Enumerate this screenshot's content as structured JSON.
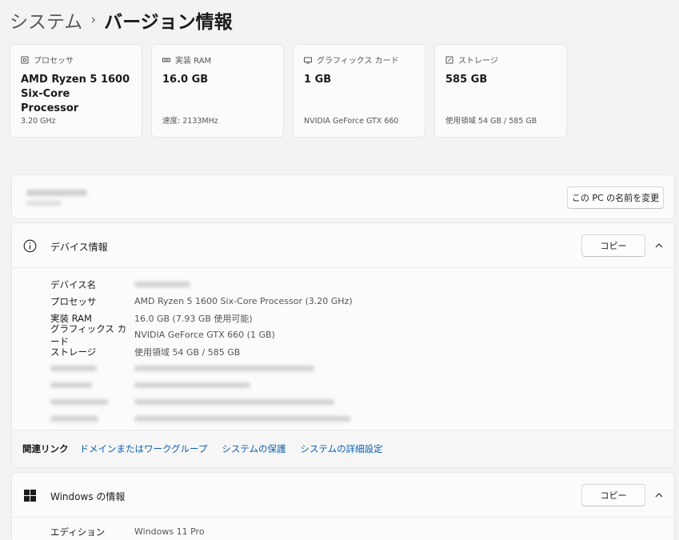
{
  "breadcrumb": {
    "parent": "システム",
    "separator": "›",
    "current": "バージョン情報"
  },
  "specs": [
    {
      "icon": "processor-chip-icon",
      "label": "プロセッサ",
      "value": "AMD Ryzen 5 1600 Six-Core Processor",
      "sub": "3.20 GHz"
    },
    {
      "icon": "memory-ram-icon",
      "label": "実装 RAM",
      "value": "16.0 GB",
      "sub": "速度: 2133MHz"
    },
    {
      "icon": "graphics-card-icon",
      "label": "グラフィックス カード",
      "value": "1 GB",
      "sub": "NVIDIA GeForce GTX 660"
    },
    {
      "icon": "storage-drive-icon",
      "label": "ストレージ",
      "value": "585 GB",
      "sub": "使用領域 54 GB / 585 GB"
    }
  ],
  "pc_panel": {
    "rename_label": "この PC の名前を変更"
  },
  "device_info": {
    "title": "デバイス情報",
    "copy_label": "コピー",
    "rows": [
      {
        "label": "デバイス名",
        "value": ""
      },
      {
        "label": "プロセッサ",
        "value": "AMD Ryzen 5 1600 Six-Core Processor (3.20 GHz)"
      },
      {
        "label": "実装 RAM",
        "value": "16.0 GB (7.93 GB 使用可能)"
      },
      {
        "label": "グラフィックス カード",
        "value": "NVIDIA GeForce GTX 660 (1 GB)"
      },
      {
        "label": "ストレージ",
        "value": "使用領域 54 GB / 585 GB"
      }
    ]
  },
  "related_links": {
    "label": "関連リンク",
    "links": [
      "ドメインまたはワークグループ",
      "システムの保護",
      "システムの詳細設定"
    ]
  },
  "windows_info": {
    "title": "Windows の情報",
    "copy_label": "コピー",
    "rows": [
      {
        "label": "エディション",
        "value": "Windows 11 Pro"
      }
    ]
  },
  "colors": {
    "accent_link": "#0f5fae",
    "background": "#f3f3f3",
    "card": "#fbfbfb"
  }
}
